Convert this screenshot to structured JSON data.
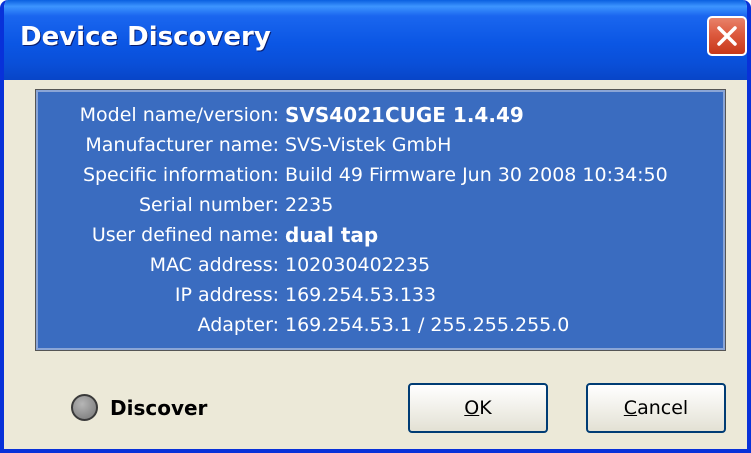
{
  "window": {
    "title": "Device Discovery"
  },
  "info": {
    "rows": [
      {
        "label": "Model name/version:",
        "value": "SVS4021CUGE  1.4.49"
      },
      {
        "label": "Manufacturer name:",
        "value": "SVS-Vistek GmbH"
      },
      {
        "label": "Specific information:",
        "value": "Build 49 Firmware Jun 30 2008 10:34:50"
      },
      {
        "label": "Serial number:",
        "value": "2235"
      },
      {
        "label": "User defined name:",
        "value": "dual tap"
      },
      {
        "label": "MAC address:",
        "value": "102030402235"
      },
      {
        "label": "IP address:",
        "value": "169.254.53.133"
      },
      {
        "label": "Adapter:",
        "value": "169.254.53.1 / 255.255.255.0"
      }
    ]
  },
  "footer": {
    "discover_label": "Discover",
    "ok_mnemonic": "O",
    "ok_rest": "K",
    "cancel_mnemonic": "C",
    "cancel_rest": "ancel"
  },
  "colors": {
    "titlebar": "#0b56e4",
    "panel_background": "#3a6cc0",
    "close_button": "#dd5a3e",
    "dialog_background": "#ece9d8"
  },
  "icons": {
    "close": "close-icon",
    "discover_indicator": "status-led-icon"
  }
}
